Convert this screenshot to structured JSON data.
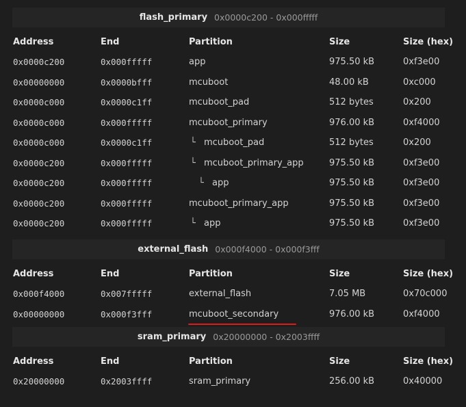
{
  "columns": {
    "address": "Address",
    "end": "End",
    "partition": "Partition",
    "size": "Size",
    "size_hex": "Size (hex)"
  },
  "tree_glyph": "└",
  "sections": [
    {
      "name": "flash_primary",
      "range": "0x0000c200 - 0x000fffff",
      "rows": [
        {
          "address": "0x0000c200",
          "end": "0x000fffff",
          "partition": "app",
          "size": "975.50 kB",
          "size_hex": "0xf3e00",
          "depth": 0
        },
        {
          "address": "0x00000000",
          "end": "0x0000bfff",
          "partition": "mcuboot",
          "size": "48.00 kB",
          "size_hex": "0xc000",
          "depth": 0
        },
        {
          "address": "0x0000c000",
          "end": "0x0000c1ff",
          "partition": "mcuboot_pad",
          "size": "512 bytes",
          "size_hex": "0x200",
          "depth": 0
        },
        {
          "address": "0x0000c000",
          "end": "0x000fffff",
          "partition": "mcuboot_primary",
          "size": "976.00 kB",
          "size_hex": "0xf4000",
          "depth": 0
        },
        {
          "address": "0x0000c000",
          "end": "0x0000c1ff",
          "partition": "mcuboot_pad",
          "size": "512 bytes",
          "size_hex": "0x200",
          "depth": 1
        },
        {
          "address": "0x0000c200",
          "end": "0x000fffff",
          "partition": "mcuboot_primary_app",
          "size": "975.50 kB",
          "size_hex": "0xf3e00",
          "depth": 1
        },
        {
          "address": "0x0000c200",
          "end": "0x000fffff",
          "partition": "app",
          "size": "975.50 kB",
          "size_hex": "0xf3e00",
          "depth": 2
        },
        {
          "address": "0x0000c200",
          "end": "0x000fffff",
          "partition": "mcuboot_primary_app",
          "size": "975.50 kB",
          "size_hex": "0xf3e00",
          "depth": 0
        },
        {
          "address": "0x0000c200",
          "end": "0x000fffff",
          "partition": "app",
          "size": "975.50 kB",
          "size_hex": "0xf3e00",
          "depth": 1
        }
      ]
    },
    {
      "name": "external_flash",
      "range": "0x000f4000 - 0x000f3fff",
      "rows": [
        {
          "address": "0x000f4000",
          "end": "0x007fffff",
          "partition": "external_flash",
          "size": "7.05 MB",
          "size_hex": "0x70c000",
          "depth": 0
        },
        {
          "address": "0x00000000",
          "end": "0x000f3fff",
          "partition": "mcuboot_secondary",
          "size": "976.00 kB",
          "size_hex": "0xf4000",
          "depth": 0
        }
      ]
    },
    {
      "name": "sram_primary",
      "range": "0x20000000 - 0x2003ffff",
      "rows": [
        {
          "address": "0x20000000",
          "end": "0x2003ffff",
          "partition": "sram_primary",
          "size": "256.00 kB",
          "size_hex": "0x40000",
          "depth": 0
        }
      ]
    }
  ],
  "annotation": {
    "color": "#e01b1b",
    "marks": "sections.1.rows.1.partition"
  }
}
